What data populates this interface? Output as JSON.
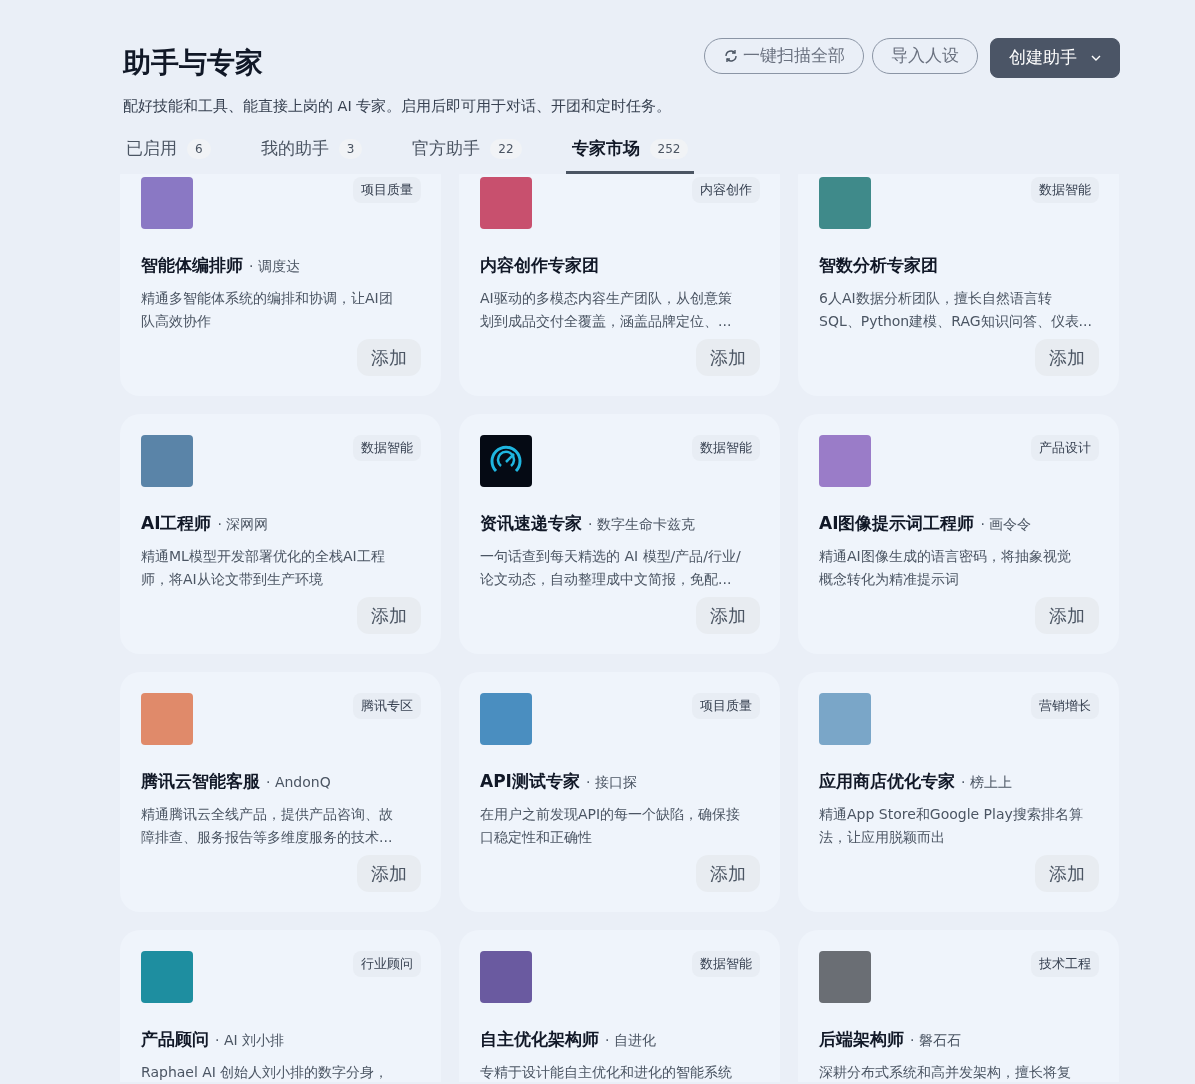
{
  "header": {
    "title": "助手与专家",
    "subtitle": "配好技能和工具、能直接上岗的 AI 专家。启用后即可用于对话、开团和定时任务。"
  },
  "actions": [
    {
      "kind": "scan",
      "label": "一键扫描全部"
    },
    {
      "kind": "import",
      "label": "导入人设"
    },
    {
      "kind": "create",
      "label": "创建助手"
    }
  ],
  "tabs": [
    {
      "label": "已启用",
      "count": "6",
      "selected": false
    },
    {
      "label": "我的助手",
      "count": "3",
      "selected": false
    },
    {
      "label": "官方助手",
      "count": "22",
      "selected": false
    },
    {
      "label": "专家市场",
      "count": "252",
      "selected": true
    }
  ],
  "experts": [
    {
      "avatar": {
        "kind": "photo",
        "color": "#8a78c4"
      },
      "tag": "项目质量",
      "name": "智能体编排师",
      "alias": "· 调度达",
      "description": [
        "精通多智能体系统的编排和协调，让AI团",
        "队高效协作"
      ],
      "button": "添加"
    },
    {
      "avatar": {
        "kind": "photo",
        "color": "#c8506e"
      },
      "tag": "内容创作",
      "name": "内容创作专家团",
      "description": [
        "AI驱动的多模态内容生产团队，从创意策",
        "划到成品交付全覆盖，涵盖品牌定位、..."
      ],
      "button": "添加"
    },
    {
      "avatar": {
        "kind": "photo",
        "color": "#3f8a8a"
      },
      "tag": "数据智能",
      "name": "智数分析专家团",
      "description": [
        "6人AI数据分析团队，擅长自然语言转",
        "SQL、Python建模、RAG知识问答、仪表..."
      ],
      "button": "添加"
    },
    {
      "avatar": {
        "kind": "photo",
        "color": "#5a84a8"
      },
      "tag": "数据智能",
      "name": "AI工程师",
      "alias": "· 深网网",
      "description": [
        "精通ML模型开发部署优化的全栈AI工程",
        "师，将AI从论文带到生产环境"
      ],
      "button": "添加"
    },
    {
      "avatar": {
        "kind": "gauge",
        "color": "#050a14"
      },
      "tag": "数据智能",
      "name": "资讯速递专家",
      "alias": "· 数字生命卡兹克",
      "description": [
        "一句话查到每天精选的 AI 模型/产品/行业/",
        "论文动态，自动整理成中文简报，免配..."
      ],
      "button": "添加"
    },
    {
      "avatar": {
        "kind": "photo",
        "color": "#9a7cc8"
      },
      "tag": "产品设计",
      "name": "AI图像提示词工程师",
      "alias": "· 画令令",
      "description": [
        "精通AI图像生成的语言密码，将抽象视觉",
        "概念转化为精准提示词"
      ],
      "button": "添加"
    },
    {
      "avatar": {
        "kind": "photo",
        "color": "#e08a6a"
      },
      "tag": "腾讯专区",
      "name": "腾讯云智能客服",
      "alias": "· AndonQ",
      "description": [
        "精通腾讯云全线产品，提供产品咨询、故",
        "障排查、服务报告等多维度服务的技术..."
      ],
      "button": "添加"
    },
    {
      "avatar": {
        "kind": "photo",
        "color": "#4a8ec0"
      },
      "tag": "项目质量",
      "name": "API测试专家",
      "alias": "· 接口探",
      "description": [
        "在用户之前发现API的每一个缺陷，确保接",
        "口稳定性和正确性"
      ],
      "button": "添加"
    },
    {
      "avatar": {
        "kind": "photo",
        "color": "#7aa6c8"
      },
      "tag": "营销增长",
      "name": "应用商店优化专家",
      "alias": "· 榜上上",
      "description": [
        "精通App Store和Google Play搜索排名算",
        "法，让应用脱颖而出"
      ],
      "button": "添加"
    },
    {
      "avatar": {
        "kind": "photo",
        "color": "#1e8ea0"
      },
      "tag": "行业顾问",
      "name": "产品顾问",
      "alias": "· AI 刘小排",
      "description": [
        "Raphael AI 创始人刘小排的数字分身，"
      ]
    },
    {
      "avatar": {
        "kind": "photo",
        "color": "#6a5aa0"
      },
      "tag": "数据智能",
      "name": "自主优化架构师",
      "alias": "· 自进化",
      "description": [
        "专精于设计能自主优化和进化的智能系统"
      ]
    },
    {
      "avatar": {
        "kind": "photo",
        "color": "#6a6e74"
      },
      "tag": "技术工程",
      "name": "后端架构师",
      "alias": "· 磐石石",
      "description": [
        "深耕分布式系统和高并发架构，擅长将复"
      ]
    }
  ]
}
